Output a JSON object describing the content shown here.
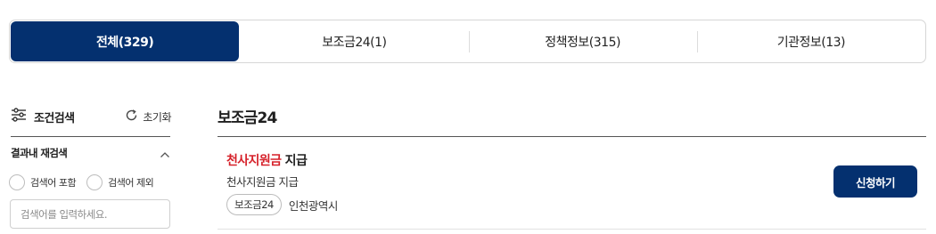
{
  "tabs": [
    {
      "label": "전체(329)",
      "active": true
    },
    {
      "label": "보조금24(1)",
      "active": false
    },
    {
      "label": "정책정보(315)",
      "active": false
    },
    {
      "label": "기관정보(13)",
      "active": false
    }
  ],
  "filter": {
    "title": "조건검색",
    "icon": "sliders-icon",
    "reset_label": "초기화",
    "reset_icon": "refresh-icon",
    "section_title": "결과내 재검색",
    "section_icon": "chevron-up-icon",
    "radio_include": "검색어 포함",
    "radio_exclude": "검색어 제외",
    "input_placeholder": "검색어를 입력하세요."
  },
  "results": {
    "section_title": "보조금24",
    "items": [
      {
        "title_highlight": "천사지원금",
        "title_rest": " 지급",
        "description": "천사지원금 지급",
        "badge": "보조금24",
        "organization": "인천광역시",
        "apply_label": "신청하기"
      }
    ]
  },
  "colors": {
    "primary": "#04306f",
    "highlight": "#d6212a"
  }
}
